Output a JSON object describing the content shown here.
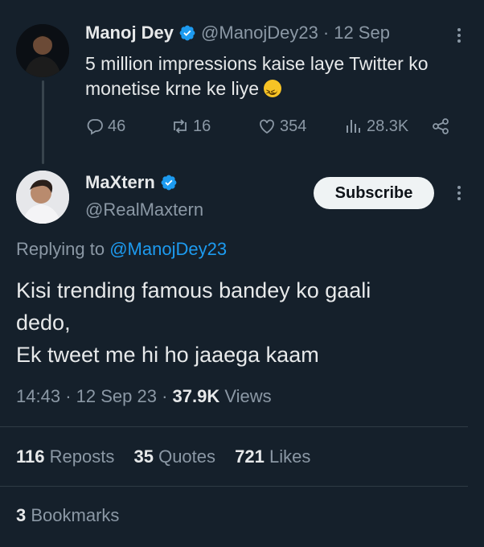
{
  "parent_tweet": {
    "author_name": "Manoj Dey",
    "handle": "@ManojDey23",
    "separator": "·",
    "date": "12 Sep",
    "text": "5 million impressions kaise laye Twitter ko monetise krne ke liye",
    "emoji_icon": "grimacing-squint-face-emoji",
    "stats": {
      "replies": "46",
      "reposts": "16",
      "likes": "354",
      "views": "28.3K"
    }
  },
  "reply_tweet": {
    "author_name": "MaXtern",
    "handle": "@RealMaxtern",
    "subscribe_label": "Subscribe",
    "replying_prefix": "Replying to",
    "replying_to": "@ManojDey23",
    "text_lines": [
      "Kisi trending famous bandey ko gaali",
      "dedo,",
      "Ek tweet me hi ho jaaega kaam"
    ],
    "time": "14:43",
    "date": "12 Sep 23",
    "separator": "·",
    "views_count": "37.9K",
    "views_label": "Views",
    "reposts_count": "116",
    "reposts_label": "Reposts",
    "quotes_count": "35",
    "quotes_label": "Quotes",
    "likes_count": "721",
    "likes_label": "Likes",
    "bookmarks_count": "3",
    "bookmarks_label": "Bookmarks"
  },
  "colors": {
    "background": "#15202b",
    "text": "#e7e9ea",
    "muted": "#8b98a5",
    "link": "#1d9bf0",
    "verified": "#1d9bf0"
  }
}
